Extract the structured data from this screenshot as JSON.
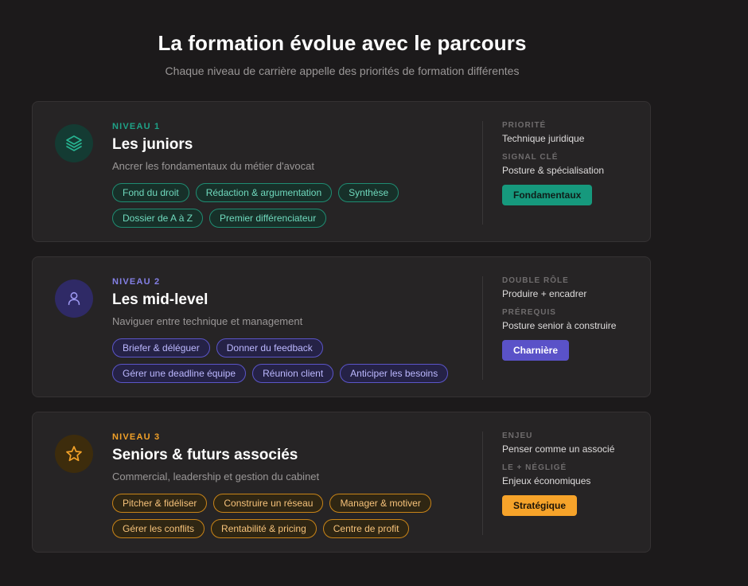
{
  "header": {
    "title": "La formation évolue avec le parcours",
    "subtitle": "Chaque niveau de carrière appelle des priorités de formation différentes"
  },
  "cards": [
    {
      "icon": "layers-icon",
      "level": "NIVEAU 1",
      "title": "Les juniors",
      "description": "Ancrer les fondamentaux du métier d'avocat",
      "tags": [
        "Fond du droit",
        "Rédaction & argumentation",
        "Synthèse",
        "Dossier de A à Z",
        "Premier différenciateur"
      ],
      "side": [
        {
          "label": "PRIORITÉ",
          "value": "Technique juridique"
        },
        {
          "label": "SIGNAL CLÉ",
          "value": "Posture & spécialisation"
        }
      ],
      "badge": "Fondamentaux",
      "accent": "#16997d"
    },
    {
      "icon": "user-icon",
      "level": "NIVEAU 2",
      "title": "Les mid-level",
      "description": "Naviguer entre technique et management",
      "tags": [
        "Briefer & déléguer",
        "Donner du feedback",
        "Gérer une deadline équipe",
        "Réunion client",
        "Anticiper les besoins"
      ],
      "side": [
        {
          "label": "DOUBLE RÔLE",
          "value": "Produire + encadrer"
        },
        {
          "label": "PRÉREQUIS",
          "value": "Posture senior à construire"
        }
      ],
      "badge": "Charnière",
      "accent": "#5a52c8"
    },
    {
      "icon": "star-icon",
      "level": "NIVEAU 3",
      "title": "Seniors & futurs associés",
      "description": "Commercial, leadership et gestion du cabinet",
      "tags": [
        "Pitcher & fidéliser",
        "Construire un réseau",
        "Manager & motiver",
        "Gérer les conflits",
        "Rentabilité & pricing",
        "Centre de profit"
      ],
      "side": [
        {
          "label": "ENJEU",
          "value": "Penser comme un associé"
        },
        {
          "label": "LE + NÉGLIGÉ",
          "value": "Enjeux économiques"
        }
      ],
      "badge": "Stratégique",
      "accent": "#f6a32a"
    }
  ]
}
